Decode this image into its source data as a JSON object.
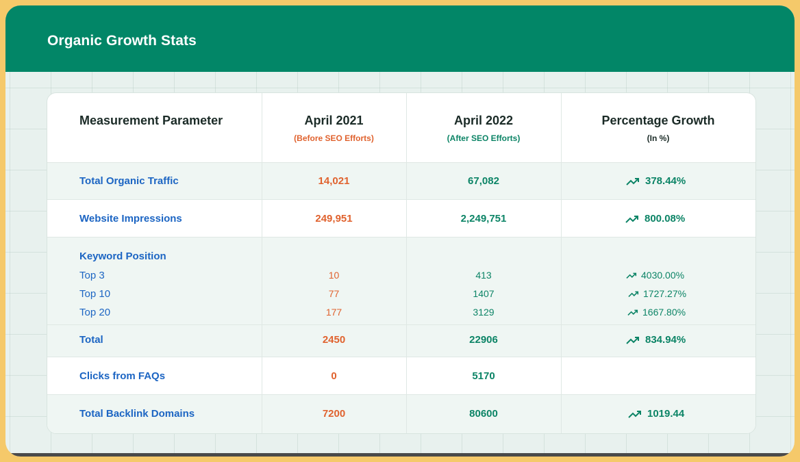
{
  "header": {
    "title": "Organic Growth Stats"
  },
  "table": {
    "columns": [
      {
        "title": "Measurement Parameter",
        "subtitle": ""
      },
      {
        "title": "April 2021",
        "subtitle": "(Before SEO Efforts)"
      },
      {
        "title": "April 2022",
        "subtitle": "(After SEO Efforts)"
      },
      {
        "title": "Percentage Growth",
        "subtitle": "(In %)"
      }
    ],
    "rows": {
      "traffic": {
        "label": "Total Organic Traffic",
        "before": "14,021",
        "after": "67,082",
        "growth": "378.44%"
      },
      "impressions": {
        "label": "Website Impressions",
        "before": "249,951",
        "after": "2,249,751",
        "growth": "800.08%"
      },
      "keyword": {
        "label": "Keyword Position",
        "items": [
          {
            "label": "Top 3",
            "before": "10",
            "after": "413",
            "growth": "4030.00%"
          },
          {
            "label": "Top 10",
            "before": "77",
            "after": "1407",
            "growth": "1727.27%"
          },
          {
            "label": "Top 20",
            "before": "177",
            "after": "3129",
            "growth": "1667.80%"
          }
        ]
      },
      "total": {
        "label": "Total",
        "before": "2450",
        "after": "22906",
        "growth": "834.94%"
      },
      "faqs": {
        "label": "Clicks from FAQs",
        "before": "0",
        "after": "5170",
        "growth": ""
      },
      "backlinks": {
        "label": "Total Backlink Domains",
        "before": "7200",
        "after": "80600",
        "growth": "1019.44"
      }
    }
  },
  "colors": {
    "brand": "#028667",
    "before": "#e0622e",
    "after": "#0c8466",
    "label": "#1c65c3",
    "frame": "#f5c96a"
  },
  "icons": {
    "growth": "trending-up-icon"
  }
}
